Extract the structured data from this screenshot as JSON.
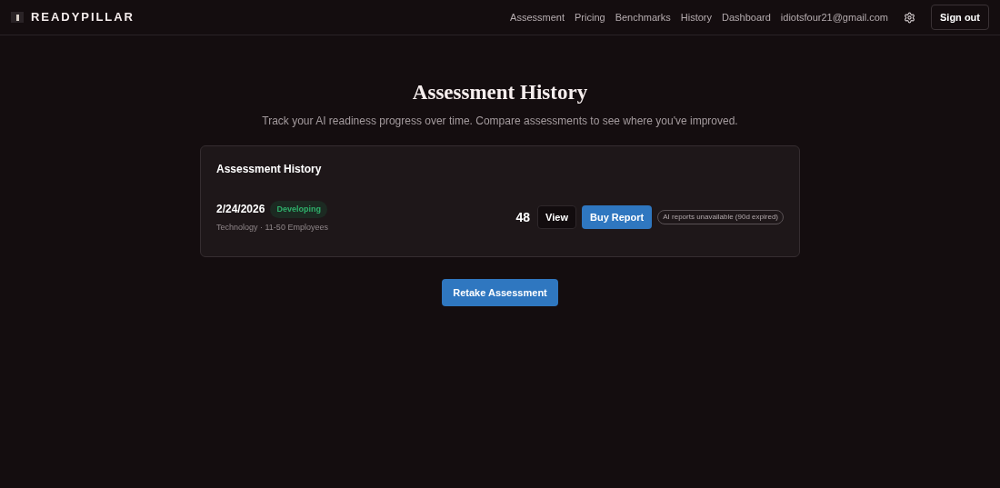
{
  "brand": "READYPILLAR",
  "nav": [
    "Assessment",
    "Pricing",
    "Benchmarks",
    "History",
    "Dashboard"
  ],
  "user_email": "idiotsfour21@gmail.com",
  "sign_out": "Sign out",
  "page": {
    "title": "Assessment History",
    "subtitle": "Track your AI readiness progress over time. Compare assessments to see where you've improved."
  },
  "card": {
    "title": "Assessment History",
    "rows": [
      {
        "date": "2/24/2026",
        "badge": "Developing",
        "meta": "Technology · 11-50 Employees",
        "score": "48",
        "view": "View",
        "buy": "Buy Report",
        "notice": "AI reports unavailable (90d expired)"
      }
    ]
  },
  "retake": "Retake Assessment"
}
